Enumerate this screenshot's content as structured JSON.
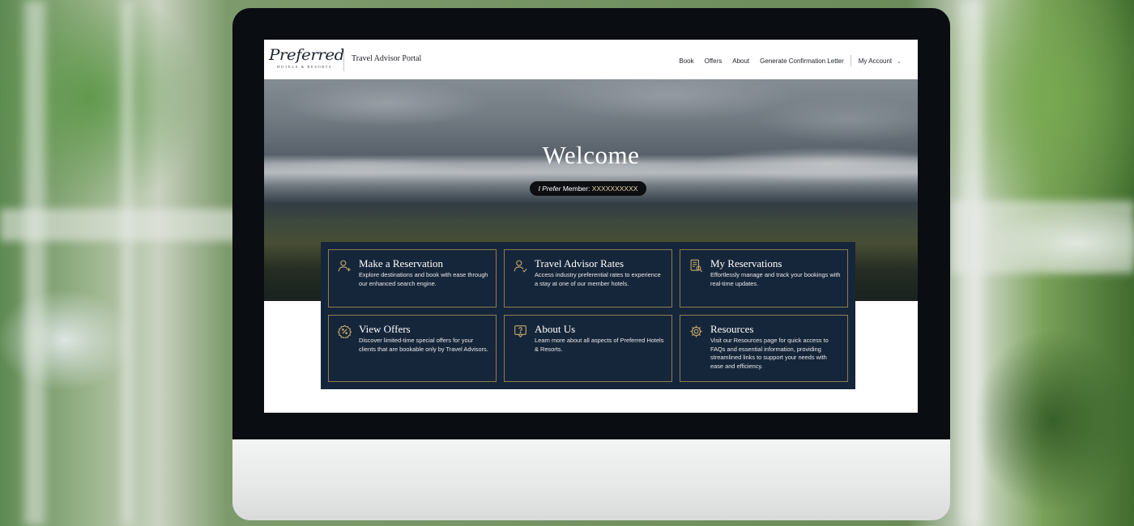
{
  "header": {
    "logo_script": "Preferred",
    "logo_sub": "HOTELS & RESORTS",
    "portal_title": "Travel Advisor Portal",
    "nav": [
      "Book",
      "Offers",
      "About",
      "Generate Confirmation Letter"
    ],
    "account_label": "My Account"
  },
  "hero": {
    "welcome": "Welcome",
    "member_prefix": "I Prefer",
    "member_label": " Member: ",
    "member_value": "XXXXXXXXXX"
  },
  "cards": [
    {
      "title": "Make a Reservation",
      "desc": "Explore destinations and book with ease through our enhanced search engine.",
      "icon": "user-add-icon"
    },
    {
      "title": "Travel Advisor Rates",
      "desc": "Access industry preferential rates to experience a stay at one of our member hotels.",
      "icon": "user-rates-icon"
    },
    {
      "title": "My Reservations",
      "desc": "Effortlessly manage and track your bookings with real-time updates.",
      "icon": "document-search-icon"
    },
    {
      "title": "View Offers",
      "desc": "Discover limited-time special offers for your clients that are bookable only by Travel Advisors.",
      "icon": "discount-badge-icon"
    },
    {
      "title": "About Us",
      "desc": "Learn more about all aspects of Preferred Hotels & Resorts.",
      "icon": "question-bubble-icon"
    },
    {
      "title": "Resources",
      "desc": "Visit our Resources page for quick access to FAQs and essential information, providing streamlined links to support your needs with ease and efficiency.",
      "icon": "gear-icon"
    }
  ],
  "colors": {
    "panel_bg": "#16263a",
    "card_border": "#8b7d55",
    "icon_gold": "#c8a96a",
    "pill_bg": "#0c0e12"
  }
}
